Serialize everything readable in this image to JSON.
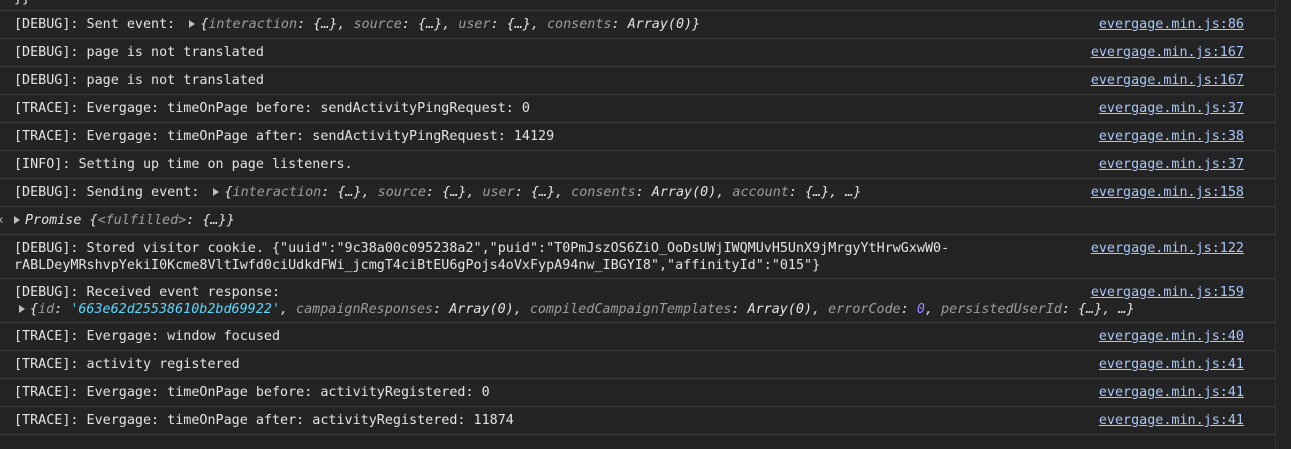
{
  "top_fragment": "}}",
  "rows": [
    {
      "prefix": "[DEBUG]: Sent event: ",
      "object": {
        "open": "{",
        "parts": [
          [
            "interaction",
            "{…}"
          ],
          [
            "source",
            "{…}"
          ],
          [
            "user",
            "{…}"
          ],
          [
            "consents",
            "Array(0)"
          ]
        ],
        "close": "}"
      },
      "source": "evergage.min.js:86"
    },
    {
      "text": "[DEBUG]: page is not translated",
      "source": "evergage.min.js:167"
    },
    {
      "text": "[DEBUG]: page is not translated",
      "source": "evergage.min.js:167"
    },
    {
      "text": "[TRACE]: Evergage: timeOnPage before: sendActivityPingRequest: 0",
      "source": "evergage.min.js:37"
    },
    {
      "text": "[TRACE]: Evergage: timeOnPage after: sendActivityPingRequest: 14129",
      "source": "evergage.min.js:38"
    },
    {
      "text": "[INFO]: Setting up time on page listeners.",
      "source": "evergage.min.js:37"
    },
    {
      "prefix": "[DEBUG]: Sending event: ",
      "object": {
        "open": "{",
        "parts": [
          [
            "interaction",
            "{…}"
          ],
          [
            "source",
            "{…}"
          ],
          [
            "user",
            "{…}"
          ],
          [
            "consents",
            "Array(0)"
          ],
          [
            "account",
            "{…}"
          ]
        ],
        "close": ", …}"
      },
      "source": "evergage.min.js:158"
    },
    {
      "promise": {
        "label": "Promise",
        "state_key": "<fulfilled>",
        "state_val": "{…}"
      }
    },
    {
      "cookie_line1": "[DEBUG]: Stored visitor cookie. {\"uuid\":\"9c38a00c095238a2\",\"puid\":\"T0PmJszOS6ZiO_OoDsUWjIWQMUvH5UnX9jMrgyYtHrwGxwW0-",
      "cookie_line2": "rABLDeyMRshvpYekiI0Kcme8VltIwfd0ciUdkdFWi_jcmgT4ciBtEU6gPojs4oVxFypA94nw_IBGYI8\",\"affinityId\":\"015\"}",
      "source": "evergage.min.js:122"
    },
    {
      "response_line1": "[DEBUG]: Received event response:",
      "response_obj": {
        "id": "'663e62d25538610b2bd69922'",
        "campaignResponses": "Array(0)",
        "compiledCampaignTemplates": "Array(0)",
        "errorCode": "0",
        "persistedUserId": "{…}",
        "tail": ", …}"
      },
      "source": "evergage.min.js:159"
    },
    {
      "text": "[TRACE]: Evergage: window focused",
      "source": "evergage.min.js:40"
    },
    {
      "text": "[TRACE]: activity registered",
      "source": "evergage.min.js:41"
    },
    {
      "text": "[TRACE]: Evergage: timeOnPage before: activityRegistered: 0",
      "source": "evergage.min.js:41"
    },
    {
      "text": "[TRACE]: Evergage: timeOnPage after: activityRegistered: 11874",
      "source": "evergage.min.js:41"
    }
  ]
}
